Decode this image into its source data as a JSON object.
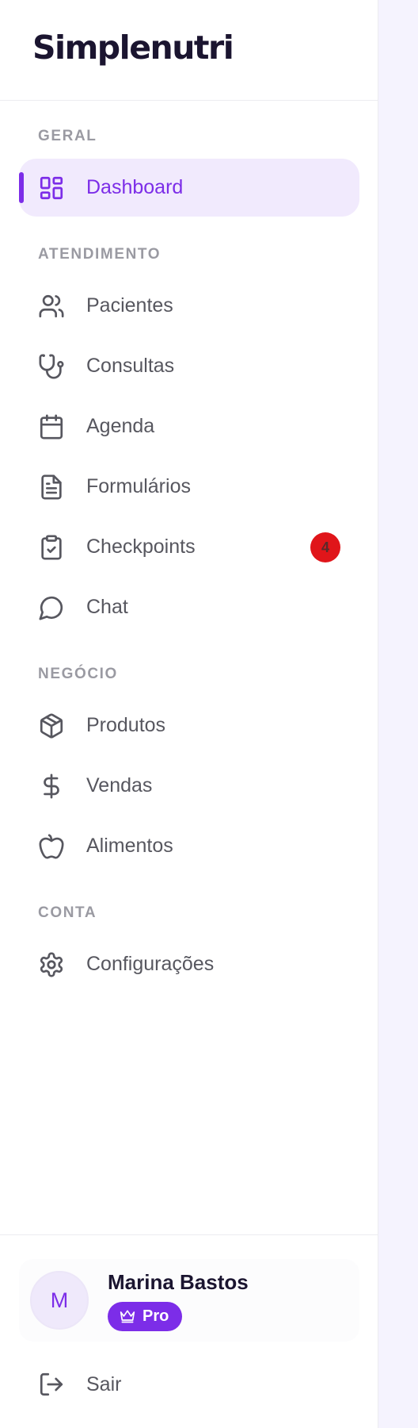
{
  "brand": {
    "name": "Simplenutri"
  },
  "colors": {
    "accent": "#7c2de8",
    "active_bg": "#f1eafd",
    "badge": "#e0151a",
    "main_bg": "#f5f3fe"
  },
  "sections": [
    {
      "label": "GERAL"
    },
    {
      "label": "ATENDIMENTO"
    },
    {
      "label": "NEGÓCIO"
    },
    {
      "label": "CONTA"
    }
  ],
  "nav": {
    "dashboard": {
      "label": "Dashboard",
      "icon": "layout-grid-icon",
      "active": true
    },
    "pacientes": {
      "label": "Pacientes",
      "icon": "users-icon"
    },
    "consultas": {
      "label": "Consultas",
      "icon": "stethoscope-icon"
    },
    "agenda": {
      "label": "Agenda",
      "icon": "calendar-icon"
    },
    "formularios": {
      "label": "Formulários",
      "icon": "file-text-icon"
    },
    "checkpoints": {
      "label": "Checkpoints",
      "icon": "clipboard-check-icon",
      "badge": "4"
    },
    "chat": {
      "label": "Chat",
      "icon": "message-circle-icon"
    },
    "produtos": {
      "label": "Produtos",
      "icon": "package-icon"
    },
    "vendas": {
      "label": "Vendas",
      "icon": "dollar-sign-icon"
    },
    "alimentos": {
      "label": "Alimentos",
      "icon": "apple-icon"
    },
    "configuracoes": {
      "label": "Configurações",
      "icon": "settings-icon"
    }
  },
  "user": {
    "initial": "M",
    "name": "Marina Bastos",
    "plan": "Pro",
    "plan_icon": "crown-icon"
  },
  "logout": {
    "label": "Sair",
    "icon": "log-out-icon"
  }
}
